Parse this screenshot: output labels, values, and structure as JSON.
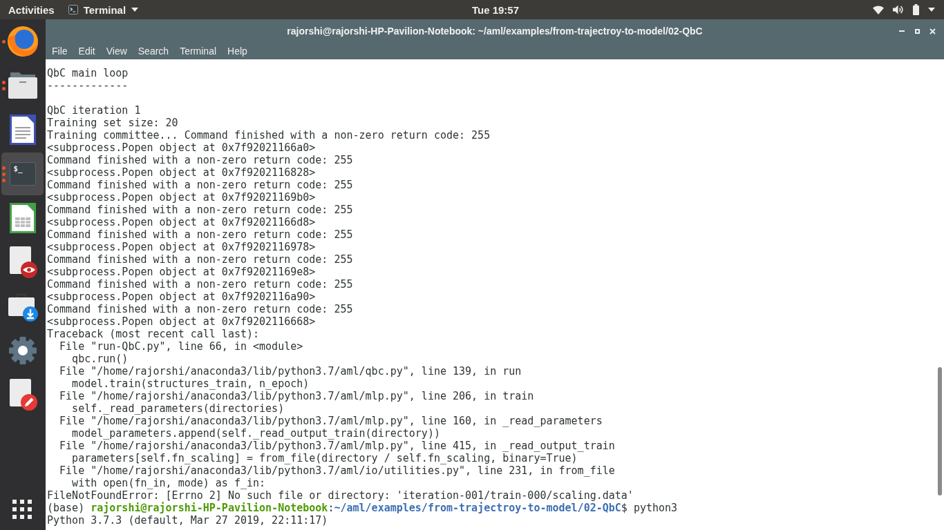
{
  "top_bar": {
    "activities": "Activities",
    "app_menu": {
      "label": "Terminal"
    },
    "clock": "Tue 19:57"
  },
  "dock": {
    "items": [
      {
        "kind": "browser",
        "selected": false,
        "indicators": [
          {
            "kind": "dot"
          }
        ]
      },
      {
        "kind": "files",
        "selected": false,
        "indicators": [
          {
            "kind": "dot"
          },
          {
            "kind": "dot"
          }
        ]
      },
      {
        "kind": "document",
        "selected": false
      },
      {
        "kind": "terminal",
        "selected": true,
        "glyph": "$_",
        "indicators": [
          {
            "kind": "dot"
          },
          {
            "kind": "dot"
          },
          {
            "kind": "dot"
          }
        ]
      },
      {
        "kind": "spreadsheet",
        "selected": false
      },
      {
        "kind": "viewer",
        "selected": false
      },
      {
        "kind": "store",
        "selected": false
      },
      {
        "kind": "settings",
        "selected": false
      },
      {
        "kind": "editor",
        "selected": false
      }
    ]
  },
  "window": {
    "title": "rajorshi@rajorshi-HP-Pavilion-Notebook: ~/aml/examples/from-trajectroy-to-model/02-QbC",
    "menu": [
      "File",
      "Edit",
      "View",
      "Search",
      "Terminal",
      "Help"
    ]
  },
  "terminal": {
    "lines": [
      {
        "kind": "output",
        "text": "QbC main loop"
      },
      {
        "kind": "output",
        "text": "-------------"
      },
      {
        "kind": "blank"
      },
      {
        "kind": "output",
        "text": "QbC iteration 1"
      },
      {
        "kind": "output",
        "text": "Training set size: 20"
      },
      {
        "kind": "output",
        "text": "Training committee... Command finished with a non-zero return code: 255"
      },
      {
        "kind": "output",
        "text": "<subprocess.Popen object at 0x7f92021166a0>"
      },
      {
        "kind": "output",
        "text": "Command finished with a non-zero return code: 255"
      },
      {
        "kind": "output",
        "text": "<subprocess.Popen object at 0x7f9202116828>"
      },
      {
        "kind": "output",
        "text": "Command finished with a non-zero return code: 255"
      },
      {
        "kind": "output",
        "text": "<subprocess.Popen object at 0x7f92021169b0>"
      },
      {
        "kind": "output",
        "text": "Command finished with a non-zero return code: 255"
      },
      {
        "kind": "output",
        "text": "<subprocess.Popen object at 0x7f92021166d8>"
      },
      {
        "kind": "output",
        "text": "Command finished with a non-zero return code: 255"
      },
      {
        "kind": "output",
        "text": "<subprocess.Popen object at 0x7f9202116978>"
      },
      {
        "kind": "output",
        "text": "Command finished with a non-zero return code: 255"
      },
      {
        "kind": "output",
        "text": "<subprocess.Popen object at 0x7f92021169e8>"
      },
      {
        "kind": "output",
        "text": "Command finished with a non-zero return code: 255"
      },
      {
        "kind": "output",
        "text": "<subprocess.Popen object at 0x7f9202116a90>"
      },
      {
        "kind": "output",
        "text": "Command finished with a non-zero return code: 255"
      },
      {
        "kind": "output",
        "text": "<subprocess.Popen object at 0x7f9202116668>"
      },
      {
        "kind": "output",
        "text": "Traceback (most recent call last):"
      },
      {
        "kind": "output",
        "text": "  File \"run-QbC.py\", line 66, in <module>"
      },
      {
        "kind": "output",
        "text": "    qbc.run()"
      },
      {
        "kind": "output",
        "text": "  File \"/home/rajorshi/anaconda3/lib/python3.7/aml/qbc.py\", line 139, in run"
      },
      {
        "kind": "output",
        "text": "    model.train(structures_train, n_epoch)"
      },
      {
        "kind": "output",
        "text": "  File \"/home/rajorshi/anaconda3/lib/python3.7/aml/mlp.py\", line 206, in train"
      },
      {
        "kind": "output",
        "text": "    self._read_parameters(directories)"
      },
      {
        "kind": "output",
        "text": "  File \"/home/rajorshi/anaconda3/lib/python3.7/aml/mlp.py\", line 160, in _read_parameters"
      },
      {
        "kind": "output",
        "text": "    model_parameters.append(self._read_output_train(directory))"
      },
      {
        "kind": "output",
        "text": "  File \"/home/rajorshi/anaconda3/lib/python3.7/aml/mlp.py\", line 415, in _read_output_train"
      },
      {
        "kind": "output",
        "text": "    parameters[self.fn_scaling] = from_file(directory / self.fn_scaling, binary=True)"
      },
      {
        "kind": "output",
        "text": "  File \"/home/rajorshi/anaconda3/lib/python3.7/aml/io/utilities.py\", line 231, in from_file"
      },
      {
        "kind": "output",
        "text": "    with open(fn_in, mode) as f_in:"
      },
      {
        "kind": "output",
        "text": "FileNotFoundError: [Errno 2] No such file or directory: 'iteration-001/train-000/scaling.data'"
      },
      {
        "kind": "prompt",
        "segments": [
          {
            "kind": "plain",
            "text": "(base) "
          },
          {
            "kind": "user",
            "text": "rajorshi@rajorshi-HP-Pavilion-Notebook"
          },
          {
            "kind": "plain",
            "text": ":"
          },
          {
            "kind": "path",
            "text": "~/aml/examples/from-trajectroy-to-model/02-QbC"
          },
          {
            "kind": "plain",
            "text": "$ python3"
          }
        ]
      },
      {
        "kind": "output",
        "text": "Python 3.7.3 (default, Mar 27 2019, 22:11:17)"
      }
    ]
  }
}
